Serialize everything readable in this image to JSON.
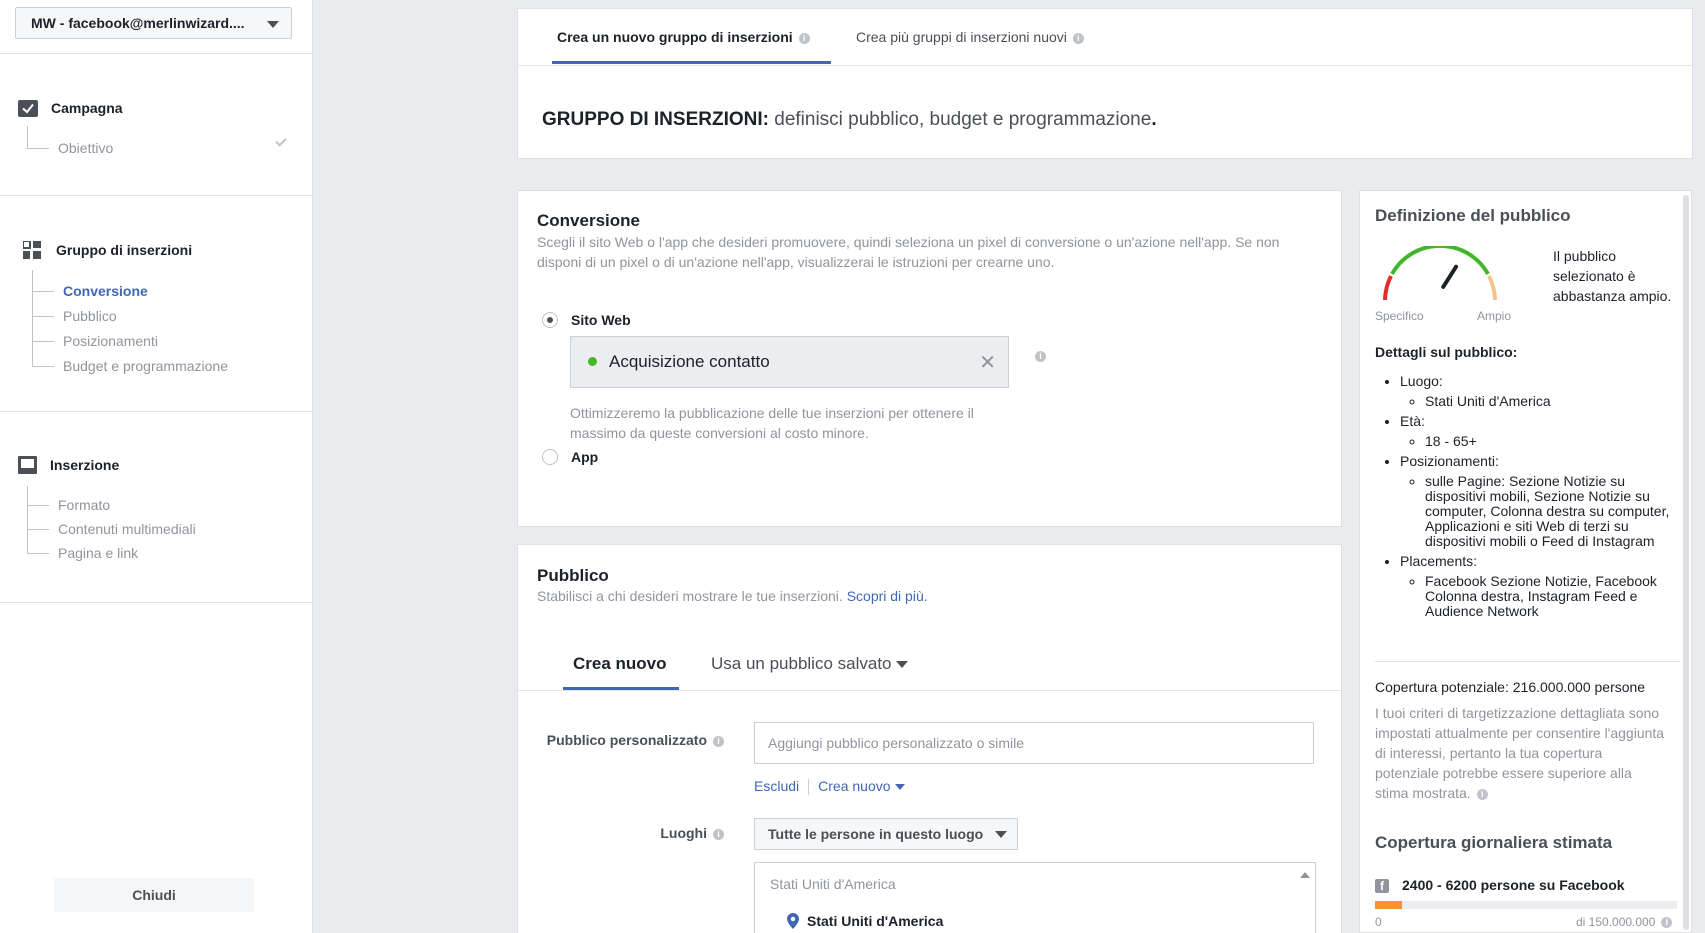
{
  "sidebar": {
    "account": "MW - facebook@merlinwizard....",
    "campaign": {
      "title": "Campagna",
      "items": [
        "Obiettivo"
      ]
    },
    "adset": {
      "title": "Gruppo di inserzioni",
      "items": [
        "Conversione",
        "Pubblico",
        "Posizionamenti",
        "Budget e programmazione"
      ]
    },
    "ad": {
      "title": "Inserzione",
      "items": [
        "Formato",
        "Contenuti multimediali",
        "Pagina e link"
      ]
    },
    "close_label": "Chiudi"
  },
  "top": {
    "tabs": [
      "Crea un nuovo gruppo di inserzioni",
      "Crea più gruppi di inserzioni nuovi"
    ],
    "heading_bold": "GRUPPO DI INSERZIONI:",
    "heading_desc": " definisci pubblico, budget e programmazione",
    "heading_end": "."
  },
  "conversion": {
    "title": "Conversione",
    "desc": "Scegli il sito Web o l'app che desideri promuovere, quindi seleziona un pixel di conversione o un'azione nell'app. Se non disponi di un pixel o di un'azione nell'app, visualizzerai le istruzioni per crearne uno.",
    "option_web": "Sito Web",
    "pixel": "Acquisizione contatto",
    "note": "Ottimizzeremo la pubblicazione delle tue inserzioni per ottenere il massimo da queste conversioni al costo minore.",
    "option_app": "App"
  },
  "audience": {
    "title": "Pubblico",
    "desc": "Stabilisci a chi desideri mostrare le tue inserzioni.",
    "learn_more": "Scopri di più.",
    "tab_new": "Crea nuovo",
    "tab_saved": "Usa un pubblico salvato",
    "custom_label": "Pubblico personalizzato",
    "custom_placeholder": "Aggiungi pubblico personalizzato o simile",
    "exclude": "Escludi",
    "create_new": "Crea nuovo",
    "places_label": "Luoghi",
    "places_select": "Tutte le persone in questo luogo",
    "loc_header": "Stati Uniti d'America",
    "loc_item": "Stati Uniti d'America"
  },
  "definition": {
    "title": "Definizione del pubblico",
    "gauge_note": "Il pubblico selezionato è abbastanza ampio.",
    "gauge_min": "Specifico",
    "gauge_max": "Ampio",
    "gauge_level": 0.68,
    "details_title": "Dettagli sul pubblico:",
    "details": [
      {
        "label": "Luogo:",
        "values": [
          "Stati Uniti d'America"
        ]
      },
      {
        "label": "Età:",
        "values": [
          "18 - 65+"
        ]
      },
      {
        "label": "Posizionamenti:",
        "values": [
          "sulle Pagine: Sezione Notizie su dispositivi mobili, Sezione Notizie su computer, Colonna destra su computer, Applicazioni e siti Web di terzi su dispositivi mobili o Feed di Instagram"
        ]
      },
      {
        "label": "Placements:",
        "values": [
          "Facebook Sezione Notizie, Facebook Colonna destra, Instagram Feed e Audience Network"
        ]
      }
    ],
    "reach": "Copertura potenziale: 216.000.000 persone",
    "reach_note": "I tuoi criteri di targetizzazione dettagliata sono impostati attualmente per consentire l'aggiunta di interessi, pertanto la tua copertura potenziale potrebbe essere superiore alla stima mostrata.",
    "daily_title": "Copertura giornaliera stimata",
    "daily_value": "2400 - 6200 persone su Facebook",
    "daily_fraction": 0.09,
    "bar_min": "0",
    "bar_max": "di 150.000.000"
  },
  "colors": {
    "accent": "#4267b2",
    "pixel_active": "#42b72a",
    "reach_bar": "#f7923b"
  }
}
